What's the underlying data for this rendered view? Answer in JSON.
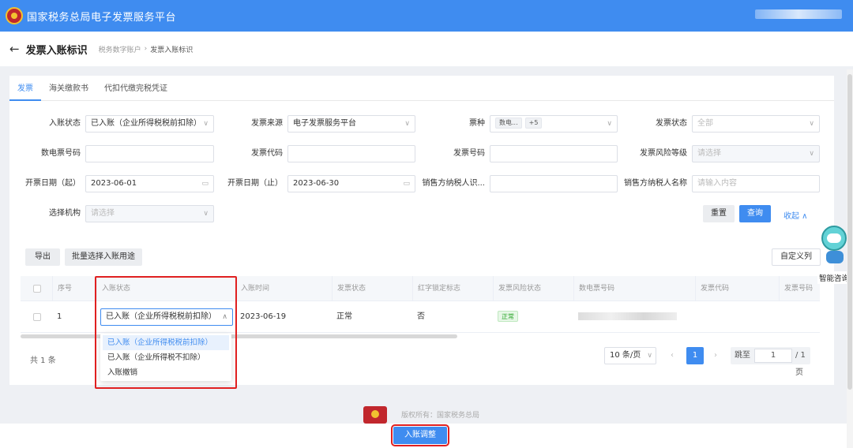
{
  "topbar": {
    "site_title": "国家税务总局电子发票服务平台"
  },
  "header": {
    "back_icon": "←",
    "page_title": "发票入账标识",
    "breadcrumb": [
      "税务数字账户",
      "发票入账标识"
    ],
    "breadcrumb_sep": "›"
  },
  "tabs": [
    {
      "label": "发票",
      "active": true
    },
    {
      "label": "海关缴款书",
      "active": false
    },
    {
      "label": "代扣代缴完税凭证",
      "active": false
    }
  ],
  "filters": {
    "row1": {
      "entry_status": {
        "label": "入账状态",
        "value": "已入账（企业所得税税前扣除）"
      },
      "invoice_source": {
        "label": "发票来源",
        "value": "电子发票服务平台"
      },
      "ticket_type": {
        "label": "票种",
        "tag": "数电...",
        "more": "+5"
      },
      "invoice_status": {
        "label": "发票状态",
        "value": "全部"
      }
    },
    "row2": {
      "digital_no": {
        "label": "数电票号码",
        "value": ""
      },
      "invoice_code": {
        "label": "发票代码",
        "value": ""
      },
      "invoice_no": {
        "label": "发票号码",
        "value": ""
      },
      "risk_level": {
        "label": "发票风险等级",
        "placeholder": "请选择"
      }
    },
    "row3": {
      "date_start": {
        "label": "开票日期（起）",
        "value": "2023-06-01"
      },
      "date_end": {
        "label": "开票日期（止）",
        "value": "2023-06-30"
      },
      "seller_id": {
        "label": "销售方纳税人识...",
        "value": ""
      },
      "seller_name": {
        "label": "销售方纳税人名称",
        "placeholder": "请输入内容"
      }
    },
    "row4": {
      "org": {
        "label": "选择机构",
        "placeholder": "请选择"
      }
    },
    "reset_label": "重置",
    "search_label": "查询",
    "collapse_label": "收起 ∧"
  },
  "toolbar": {
    "export_label": "导出",
    "batch_label": "批量选择入账用途",
    "custom_cols_label": "自定义列"
  },
  "table": {
    "headers": [
      "序号",
      "入账状态",
      "入账时间",
      "发票状态",
      "红字锁定标志",
      "发票风险状态",
      "数电票号码",
      "发票代码",
      "发票号码"
    ],
    "rows": [
      {
        "index": "1",
        "entry_status": "已入账（企业所得税税前扣除）",
        "entry_time": "2023-06-19",
        "invoice_status": "正常",
        "red_lock": "否",
        "risk_status": "正常"
      }
    ]
  },
  "dropdown": {
    "options": [
      "已入账（企业所得税税前扣除）",
      "已入账（企业所得税不扣除）",
      "入账撤销"
    ],
    "selected_index": 0
  },
  "pagination": {
    "total": "共 1 条",
    "page_size": "10 条/页",
    "current_page": "1",
    "jump_label": "跳至",
    "jump_value": "1",
    "total_pages": "/ 1 页"
  },
  "footer": {
    "copyright": "版权所有：国家税务总局",
    "adjust_label": "入账调整"
  },
  "assistant": {
    "label": "智能咨询"
  },
  "colors": {
    "primary": "#3f8cf0",
    "highlight": "#e02020"
  }
}
